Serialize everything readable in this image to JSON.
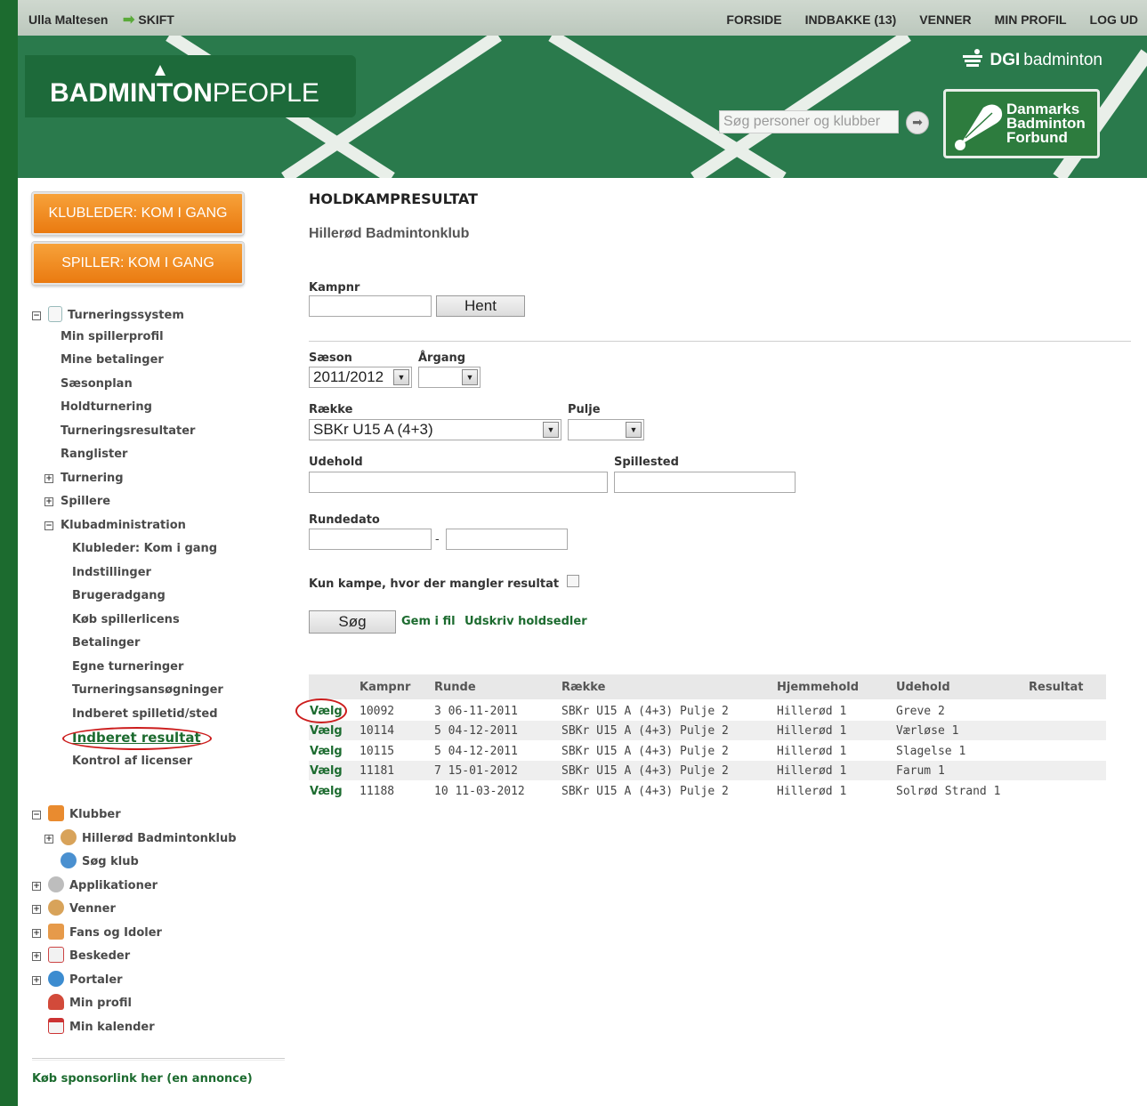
{
  "topbar": {
    "user_name": "Ulla Maltesen",
    "switch_label": "SKIFT",
    "nav": [
      "FORSIDE",
      "INDBAKKE (13)",
      "VENNER",
      "MIN PROFIL",
      "LOG UD"
    ]
  },
  "banner": {
    "logo_bold": "BADMINTON",
    "logo_light": "PEOPLE",
    "dgi_bold": "DGI",
    "dgi_rest": "badminton",
    "search_placeholder": "Søg personer og klubber",
    "dbf_line1": "Danmarks",
    "dbf_line2": "Badminton",
    "dbf_line3": "Forbund"
  },
  "sidebar": {
    "button_klubleder": "KLUBLEDER: KOM I GANG",
    "button_spiller": "SPILLER: KOM I GANG",
    "turneringssystem": "Turneringssystem",
    "level1": [
      "Min spillerprofil",
      "Mine betalinger",
      "Sæsonplan",
      "Holdturnering",
      "Turneringsresultater",
      "Ranglister"
    ],
    "turnering": "Turnering",
    "spillere": "Spillere",
    "klubadministration": "Klubadministration",
    "klubadmin_items": [
      "Klubleder: Kom i gang",
      "Indstillinger",
      "Brugeradgang",
      "Køb spillerlicens",
      "Betalinger",
      "Egne turneringer",
      "Turneringsansøgninger",
      "Indberet spilletid/sted",
      "Indberet resultat",
      "Kontrol af licenser"
    ],
    "klubber": "Klubber",
    "klub_name": "Hillerød Badmintonklub",
    "soeg_klub": "Søg klub",
    "applikationer": "Applikationer",
    "venner": "Venner",
    "fans": "Fans og Idoler",
    "beskeder": "Beskeder",
    "portaler": "Portaler",
    "min_profil": "Min profil",
    "min_kalender": "Min kalender",
    "sponsor_link": "Køb sponsorlink her (en annonce)"
  },
  "main": {
    "title": "HOLDKAMPRESULTAT",
    "club": "Hillerød Badmintonklub",
    "kampnr_label": "Kampnr",
    "hent_button": "Hent",
    "saeson_label": "Sæson",
    "saeson_value": "2011/2012",
    "aargang_label": "Årgang",
    "aargang_value": "",
    "raekke_label": "Række",
    "raekke_value": "SBKr U15 A (4+3)",
    "pulje_label": "Pulje",
    "pulje_value": "",
    "udehold_label": "Udehold",
    "spillested_label": "Spillested",
    "rundedato_label": "Rundedato",
    "date_sep": "-",
    "missing_label": "Kun kampe, hvor der mangler resultat",
    "soeg_button": "Søg",
    "gem_link": "Gem i fil",
    "udskriv_link": "Udskriv holdsedler"
  },
  "table": {
    "headers": [
      "Kampnr",
      "Runde",
      "Række",
      "Hjemmehold",
      "Udehold",
      "Resultat"
    ],
    "select_label": "Vælg",
    "rows": [
      {
        "kampnr": "10092",
        "runde": "3 06-11-2011",
        "raekke": "SBKr U15 A (4+3) Pulje 2",
        "hjemmehold": "Hillerød 1",
        "udehold": "Greve 2",
        "resultat": ""
      },
      {
        "kampnr": "10114",
        "runde": "5 04-12-2011",
        "raekke": "SBKr U15 A (4+3) Pulje 2",
        "hjemmehold": "Hillerød 1",
        "udehold": "Værløse 1",
        "resultat": ""
      },
      {
        "kampnr": "10115",
        "runde": "5 04-12-2011",
        "raekke": "SBKr U15 A (4+3) Pulje 2",
        "hjemmehold": "Hillerød 1",
        "udehold": "Slagelse 1",
        "resultat": ""
      },
      {
        "kampnr": "11181",
        "runde": "7 15-01-2012",
        "raekke": "SBKr U15 A (4+3) Pulje 2",
        "hjemmehold": "Hillerød 1",
        "udehold": "Farum 1",
        "resultat": ""
      },
      {
        "kampnr": "11188",
        "runde": "10 11-03-2012",
        "raekke": "SBKr U15 A (4+3) Pulje 2",
        "hjemmehold": "Hillerød 1",
        "udehold": "Solrød Strand 1",
        "resultat": ""
      }
    ]
  },
  "colors": {
    "brand_green": "#1c6b2f",
    "banner_green": "#2a7a4c",
    "orange": "#ea7a10",
    "annotation_red": "#cc1d1d"
  }
}
